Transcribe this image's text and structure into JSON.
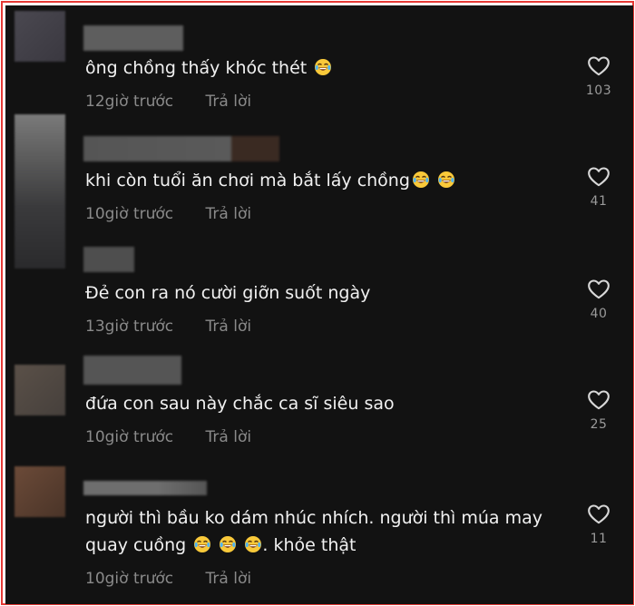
{
  "colors": {
    "background": "#121212",
    "border": "#e53935",
    "text": "#f1f1f1",
    "muted": "#8a8a8a"
  },
  "comments": [
    {
      "text": "ông chồng thấy khóc thét ",
      "emojis": [
        "face-with-tears-of-joy"
      ],
      "time": "12giờ trước",
      "reply": "Trả lời",
      "likes": "103"
    },
    {
      "text": "khi còn tuổi ăn chơi mà bắt lấy chồng",
      "emojis": [
        "face-with-tears-of-joy",
        "face-with-tears-of-joy"
      ],
      "time": "10giờ trước",
      "reply": "Trả lời",
      "likes": "41"
    },
    {
      "text": "Đẻ con ra nó cười giỡn suốt ngày",
      "emojis": [],
      "time": "13giờ trước",
      "reply": "Trả lời",
      "likes": "40"
    },
    {
      "text": "đứa con sau này chắc ca sĩ siêu sao",
      "emojis": [],
      "time": "10giờ trước",
      "reply": "Trả lời",
      "likes": "25"
    },
    {
      "text": "người thì bầu ko dám nhúc nhích. người thì múa may",
      "text2": "quay cuồng",
      "text3": ". khỏe thật",
      "emojis": [
        "face-with-tears-of-joy",
        "face-with-tears-of-joy",
        "face-with-tears-of-joy"
      ],
      "time": "10giờ trước",
      "reply": "Trả lời",
      "likes": "11"
    }
  ]
}
